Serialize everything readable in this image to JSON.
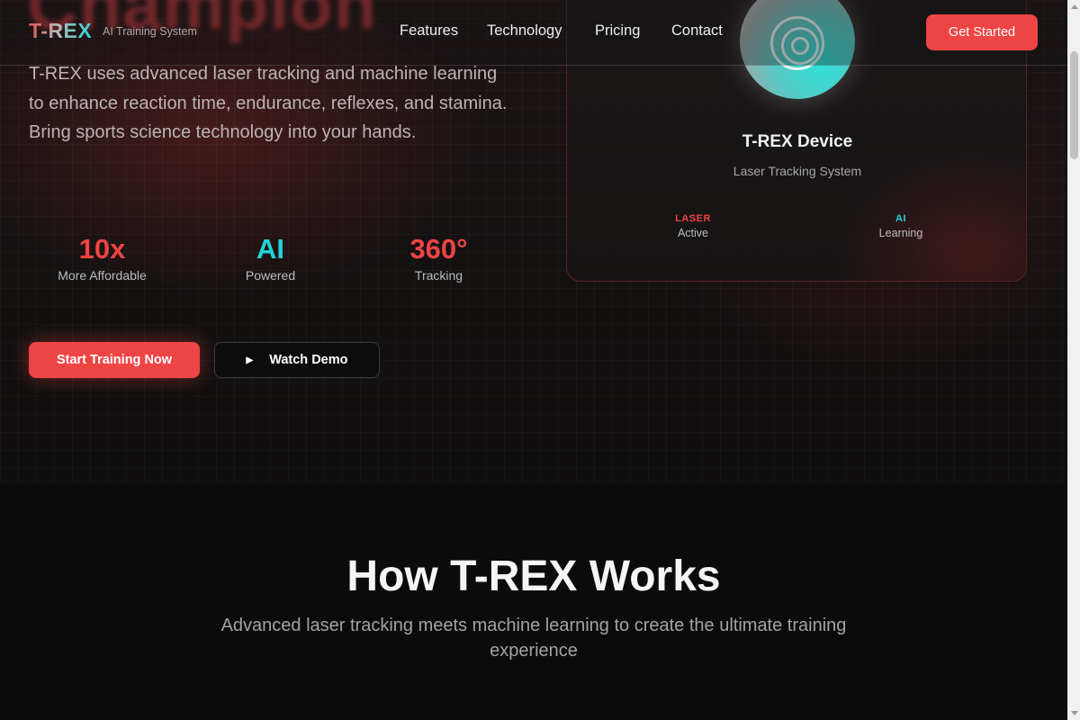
{
  "nav": {
    "logo": "T-REX",
    "tagline": "AI Training System",
    "links": [
      "Features",
      "Technology",
      "Pricing",
      "Contact"
    ],
    "cta": "Get Started"
  },
  "hero": {
    "heading_fragment": "Champion",
    "description": "T-REX uses advanced laser tracking and machine learning to enhance reaction time, endurance, reflexes, and stamina. Bring sports science technology into your hands.",
    "stats": [
      {
        "value": "10x",
        "label": "More Affordable",
        "color": "#ef4444"
      },
      {
        "value": "AI",
        "label": "Powered",
        "color": "#22d3d8"
      },
      {
        "value": "360°",
        "label": "Tracking",
        "color": "#ef4444"
      }
    ],
    "primary_button": "Start Training Now",
    "secondary_button": "Watch Demo"
  },
  "device": {
    "icon": "target-icon",
    "title": "T-REX Device",
    "subtitle": "Laser Tracking System",
    "badges": [
      {
        "top": "LASER",
        "bottom": "Active",
        "color": "#ef4444"
      },
      {
        "top": "AI",
        "bottom": "Learning",
        "color": "#22d3d8"
      }
    ]
  },
  "how": {
    "title": "How T-REX Works",
    "subtitle": "Advanced laser tracking meets machine learning to create the ultimate training experience"
  }
}
